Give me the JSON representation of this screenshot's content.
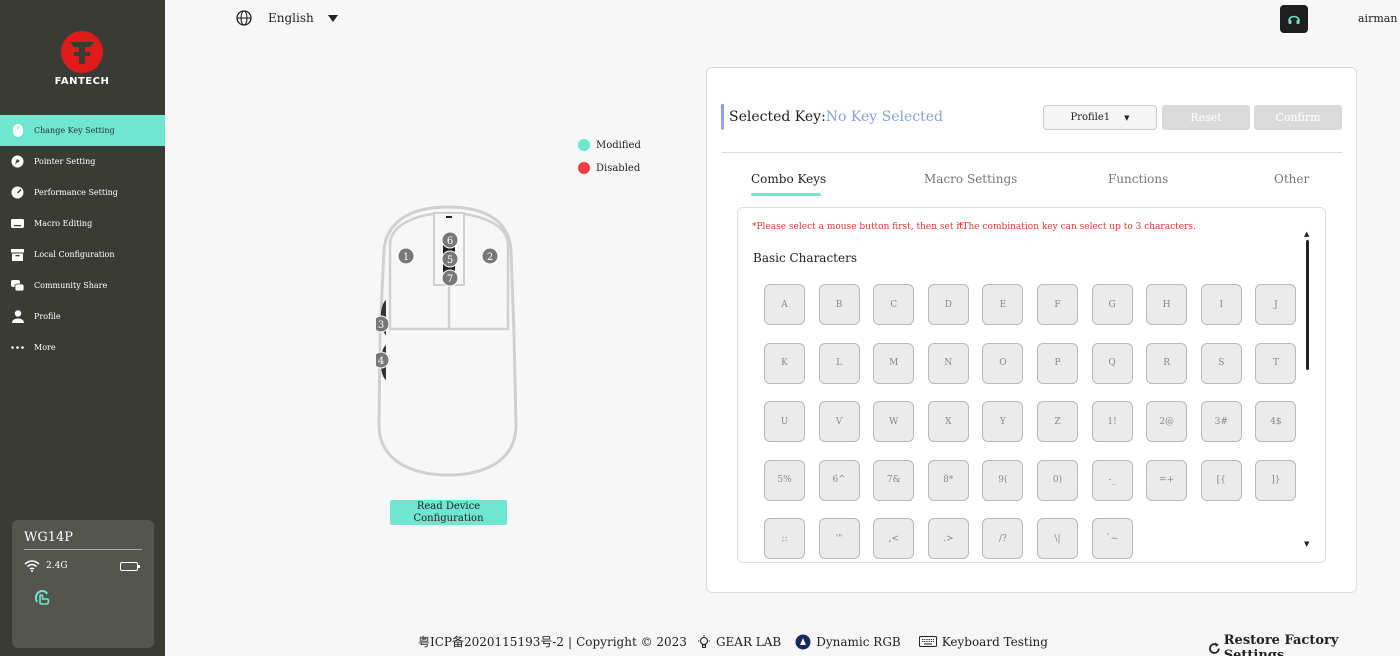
{
  "brand": {
    "logo_text": "FANTECH"
  },
  "sidebar": {
    "items": [
      {
        "label": "Change Key Setting",
        "icon": "mouse-icon",
        "active": true
      },
      {
        "label": "Pointer Setting",
        "icon": "pointer-icon"
      },
      {
        "label": "Performance Setting",
        "icon": "gauge-icon"
      },
      {
        "label": "Macro Editing",
        "icon": "keyboard-icon"
      },
      {
        "label": "Local Configuration",
        "icon": "archive-icon"
      },
      {
        "label": "Community Share",
        "icon": "chat-icon"
      },
      {
        "label": "Profile",
        "icon": "user-icon"
      },
      {
        "label": "More",
        "icon": "more-icon"
      }
    ]
  },
  "device": {
    "name": "WG14P",
    "connection": "2.4G"
  },
  "header": {
    "language": "English",
    "user": "airman"
  },
  "legend": {
    "modified": "Modified",
    "disabled": "Disabled",
    "modified_color": "#6ee6d0",
    "disabled_color": "#f04040"
  },
  "mouse": {
    "buttons": [
      "1",
      "2",
      "3",
      "4",
      "5",
      "6",
      "7"
    ],
    "read_button": "Read Device Configuration"
  },
  "panel": {
    "selected_label": "Selected Key:",
    "selected_value": "No Key Selected",
    "profile": "Profile1",
    "reset": "Reset",
    "confirm": "Confirm",
    "tabs": [
      "Combo Keys",
      "Macro Settings",
      "Functions",
      "Other"
    ],
    "hint1": "*Please select a mouse button first, then set it.",
    "hint2": "*The combination key can select up to 3 characters.",
    "section_title": "Basic Characters",
    "keys": [
      [
        "A",
        "B",
        "C",
        "D",
        "E",
        "F",
        "G",
        "H",
        "I",
        "J"
      ],
      [
        "K",
        "L",
        "M",
        "N",
        "O",
        "P",
        "Q",
        "R",
        "S",
        "T"
      ],
      [
        "U",
        "V",
        "W",
        "X",
        "Y",
        "Z",
        "1!",
        "2@",
        "3#",
        "4$"
      ],
      [
        "5%",
        "6^",
        "7&",
        "8*",
        "9(",
        "0)",
        "-_",
        "=+",
        "[{",
        "]}"
      ],
      [
        ";:",
        "'\"",
        ",<",
        ".>",
        "/?",
        "\\|",
        "`~"
      ]
    ]
  },
  "footer": {
    "icp": "粤ICP备2020115193号-2",
    "copyright": "Copyright © 2023",
    "gear_lab": "GEAR LAB",
    "dynamic_rgb": "Dynamic RGB",
    "keyboard_testing": "Keyboard Testing",
    "restore": "Restore Factory Settings"
  }
}
